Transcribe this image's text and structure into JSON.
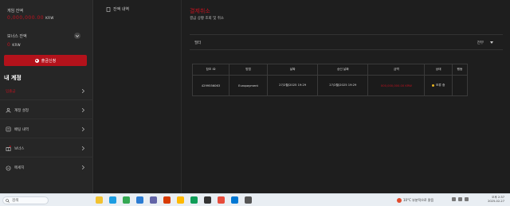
{
  "sidebar": {
    "gaming_balance_label": "게임 잔액",
    "gaming_balance_value": "0,000,000.00",
    "currency": "KRW",
    "bonus_balance_label": "보너스 잔액",
    "bonus_balance_value": "0",
    "withdraw_button": "출금신청",
    "my_account_title": "내 계정",
    "menu": [
      {
        "label": "입출금"
      },
      {
        "label": "계정 설정"
      },
      {
        "label": "배팅 내역"
      },
      {
        "label": "보너스"
      },
      {
        "label": "메세지"
      }
    ]
  },
  "subnav": {
    "transactions_label": "잔액 내역"
  },
  "main": {
    "title": "결제취소",
    "subtitle": "결금 상황 조회 및 취소",
    "filter_label": "필터",
    "filter_value": "전부",
    "table": {
      "headers": [
        "참조 ID",
        "방법",
        "날짜",
        "승인 날짜",
        "금액",
        "상태",
        "행동"
      ],
      "rows": [
        {
          "ref": "4299556063",
          "method": "Europayment",
          "date": "27/2월/2025 19:29",
          "approved": "27/2월/2025 19:29",
          "amount": "000,000,000.00 KRW",
          "status": "보류 중",
          "action": ""
        }
      ]
    }
  },
  "taskbar": {
    "search_placeholder": "검색",
    "weather": "10°C 부분적으로 맑음",
    "time": "오후 2:37",
    "date": "2025-02-27"
  },
  "colors": {
    "accent": "#c1121f",
    "status_pending": "#e7b321"
  }
}
